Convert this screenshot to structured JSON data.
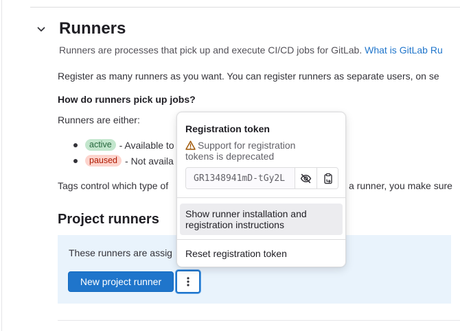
{
  "section": {
    "title": "Runners",
    "description": "Runners are processes that pick up and execute CI/CD jobs for GitLab.",
    "help_link": "What is GitLab Ru"
  },
  "content": {
    "register_text": "Register as many runners as you want. You can register runners as separate users, on se",
    "pickup_heading": "How do runners pick up jobs?",
    "either_text": "Runners are either:",
    "bullets": [
      {
        "badge": "active",
        "text": "- Available to",
        "badge_color": "#c3e6cd"
      },
      {
        "badge": "paused",
        "text": "- Not availa",
        "badge_color": "#fdd4cd"
      }
    ],
    "tags_text": "Tags control which type of",
    "tags_text_end": "a runner, you make sure"
  },
  "project_runners": {
    "heading": "Project runners",
    "panel_text": "These runners are assig",
    "new_button": "New project runner"
  },
  "dropdown": {
    "title": "Registration token",
    "warning": "Support for registration tokens is deprecated",
    "token_value": "GR1348941mD-tGy2L",
    "toggle_icon": "eye-slash-icon",
    "copy_icon": "clipboard-icon",
    "items": [
      {
        "label": "Show runner installation and registration instructions"
      },
      {
        "label": "Reset registration token"
      }
    ]
  },
  "colors": {
    "link": "#1f75cb",
    "primary": "#1f75cb",
    "panel_bg": "#e9f3fc",
    "warning": "#9e5400"
  }
}
